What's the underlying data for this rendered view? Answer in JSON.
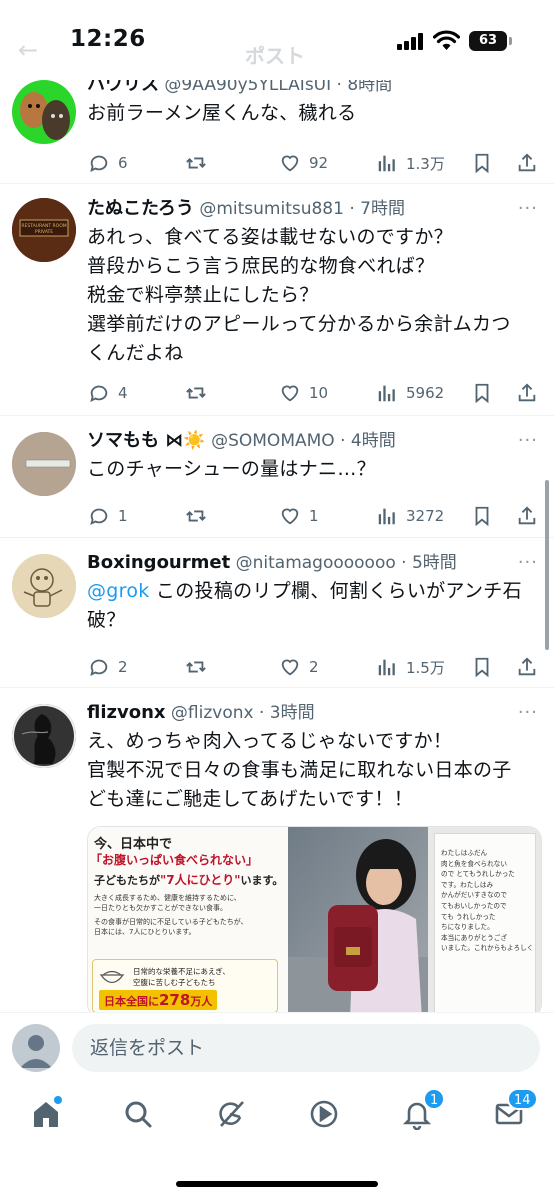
{
  "status_bar": {
    "time": "12:26",
    "battery": "63",
    "header_title": "ポスト"
  },
  "tweets": [
    {
      "name": "ハワリス",
      "handle": "@9AA90y5YLLAIsUI",
      "time": "· 8時間",
      "text": [
        "お前ラーメン屋くんな、穢れる"
      ],
      "replies": "6",
      "reposts": "",
      "likes": "92",
      "views": "1.3万"
    },
    {
      "name": "たぬこたろう",
      "handle": "@mitsumitsu881",
      "time": "· 7時間",
      "text": [
        "あれっ、食べてる姿は載せないのですか？",
        "普段からこう言う庶民的な物食べれば？",
        "税金で料亭禁止にしたら？",
        "選挙前だけのアピールって分かるから余計ムカつ",
        "くんだよね"
      ],
      "replies": "4",
      "reposts": "",
      "likes": "10",
      "views": "5962",
      "avatar_sign": "RESTAURANT ROOM PRIVATE"
    },
    {
      "name": "ソマもも ⋈☀️",
      "handle": "@SOMOMAMO",
      "time": "· 4時間",
      "text": [
        "このチャーシューの量はナニ…？"
      ],
      "replies": "1",
      "reposts": "",
      "likes": "1",
      "views": "3272"
    },
    {
      "name": "Boxingourmet",
      "handle": "@nitamagooooooo",
      "time": "· 5時間",
      "mention": "@grok",
      "text": [
        " この投稿のリプ欄、何割くらいがアンチ石",
        "破？"
      ],
      "replies": "2",
      "reposts": "",
      "likes": "2",
      "views": "1.5万"
    },
    {
      "name": "flizvonx",
      "handle": "@flizvonx",
      "time": "· 3時間",
      "text": [
        "え、めっちゃ肉入ってるじゃないですか！",
        "官製不況で日々の食事も満足に取れない日本の子",
        "ども達にご馳走してあげたいです！！"
      ]
    }
  ],
  "promo": {
    "line1": "今、日本中で",
    "line2": "「お腹いっぱい食べられない」",
    "line3a": "子どもたちが",
    "line3b": "\"7人にひとり\"",
    "line3c": "います。",
    "body1": "大きく成長するため、健康を維持するために、",
    "body2": "一日たりとも欠かすことができない食事。",
    "body3": "その食事が日常的に不足している子どもたちが、",
    "body4": "日本には、7人にひとりいます。",
    "box1": "日常的な栄養不足にあえぎ、",
    "box2": "空腹に苦しむ子どもたち",
    "total_prefix": "日本全国に",
    "total_num": "278",
    "total_suffix": "万人",
    "letter": [
      "わたしはふだん",
      "肉と魚を食べられない",
      "ので とてもうれしかった",
      "です。わたしはみ",
      "かんがだいすきなので",
      "てもおいしかったので",
      "ても うれしかった",
      "ちになりました。",
      "本当にありがとうござ",
      "いました。これからもよろしく"
    ]
  },
  "reply_bar": {
    "placeholder": "返信をポスト"
  },
  "tabbar": {
    "icons": [
      "home-icon",
      "search-icon",
      "grok-icon",
      "video-icon",
      "bell-icon",
      "mail-icon"
    ],
    "notifications_badge": "1",
    "messages_badge": "14"
  },
  "colors": {
    "accent": "#1d9bf0",
    "text": "#0f1419",
    "muted": "#536471"
  }
}
